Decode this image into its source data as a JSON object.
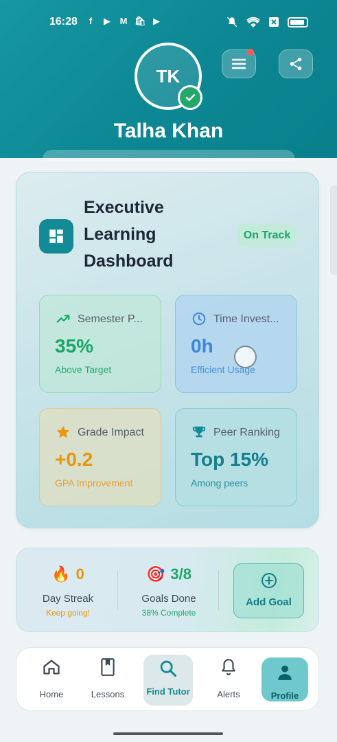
{
  "status_bar": {
    "time": "16:28",
    "left_icons": [
      "f",
      "▶",
      "M",
      "🛍",
      "▶"
    ]
  },
  "colors": {
    "header": "#0f8c98",
    "teal": "#138a96",
    "green": "#1aa667",
    "blue": "#3d86db",
    "amber": "#e8960c",
    "accent_red": "#ff5a5a"
  },
  "profile": {
    "initials": "TK",
    "name": "Talha Khan"
  },
  "dashboard": {
    "title": "Executive Learning Dashboard",
    "status": "On Track",
    "stats": [
      {
        "label": "Semester P...",
        "value": "35%",
        "sub": "Above Target",
        "icon": "trending-up-icon"
      },
      {
        "label": "Time Invest...",
        "value": "0h",
        "sub": "Efficient Usage",
        "icon": "clock-icon"
      },
      {
        "label": "Grade Impact",
        "value": "+0.2",
        "sub": "GPA Improvement",
        "icon": "star-icon"
      },
      {
        "label": "Peer Ranking",
        "value": "Top 15%",
        "sub": "Among peers",
        "icon": "trophy-icon"
      }
    ]
  },
  "streak": {
    "day_value": "0",
    "day_label": "Day Streak",
    "day_sub": "Keep going!",
    "goals_value": "3/8",
    "goals_label": "Goals Done",
    "goals_sub": "38% Complete",
    "add_goal": "Add Goal"
  },
  "nav": {
    "home": "Home",
    "lessons": "Lessons",
    "find_tutor": "Find Tutor",
    "alerts": "Alerts",
    "profile": "Profile"
  }
}
